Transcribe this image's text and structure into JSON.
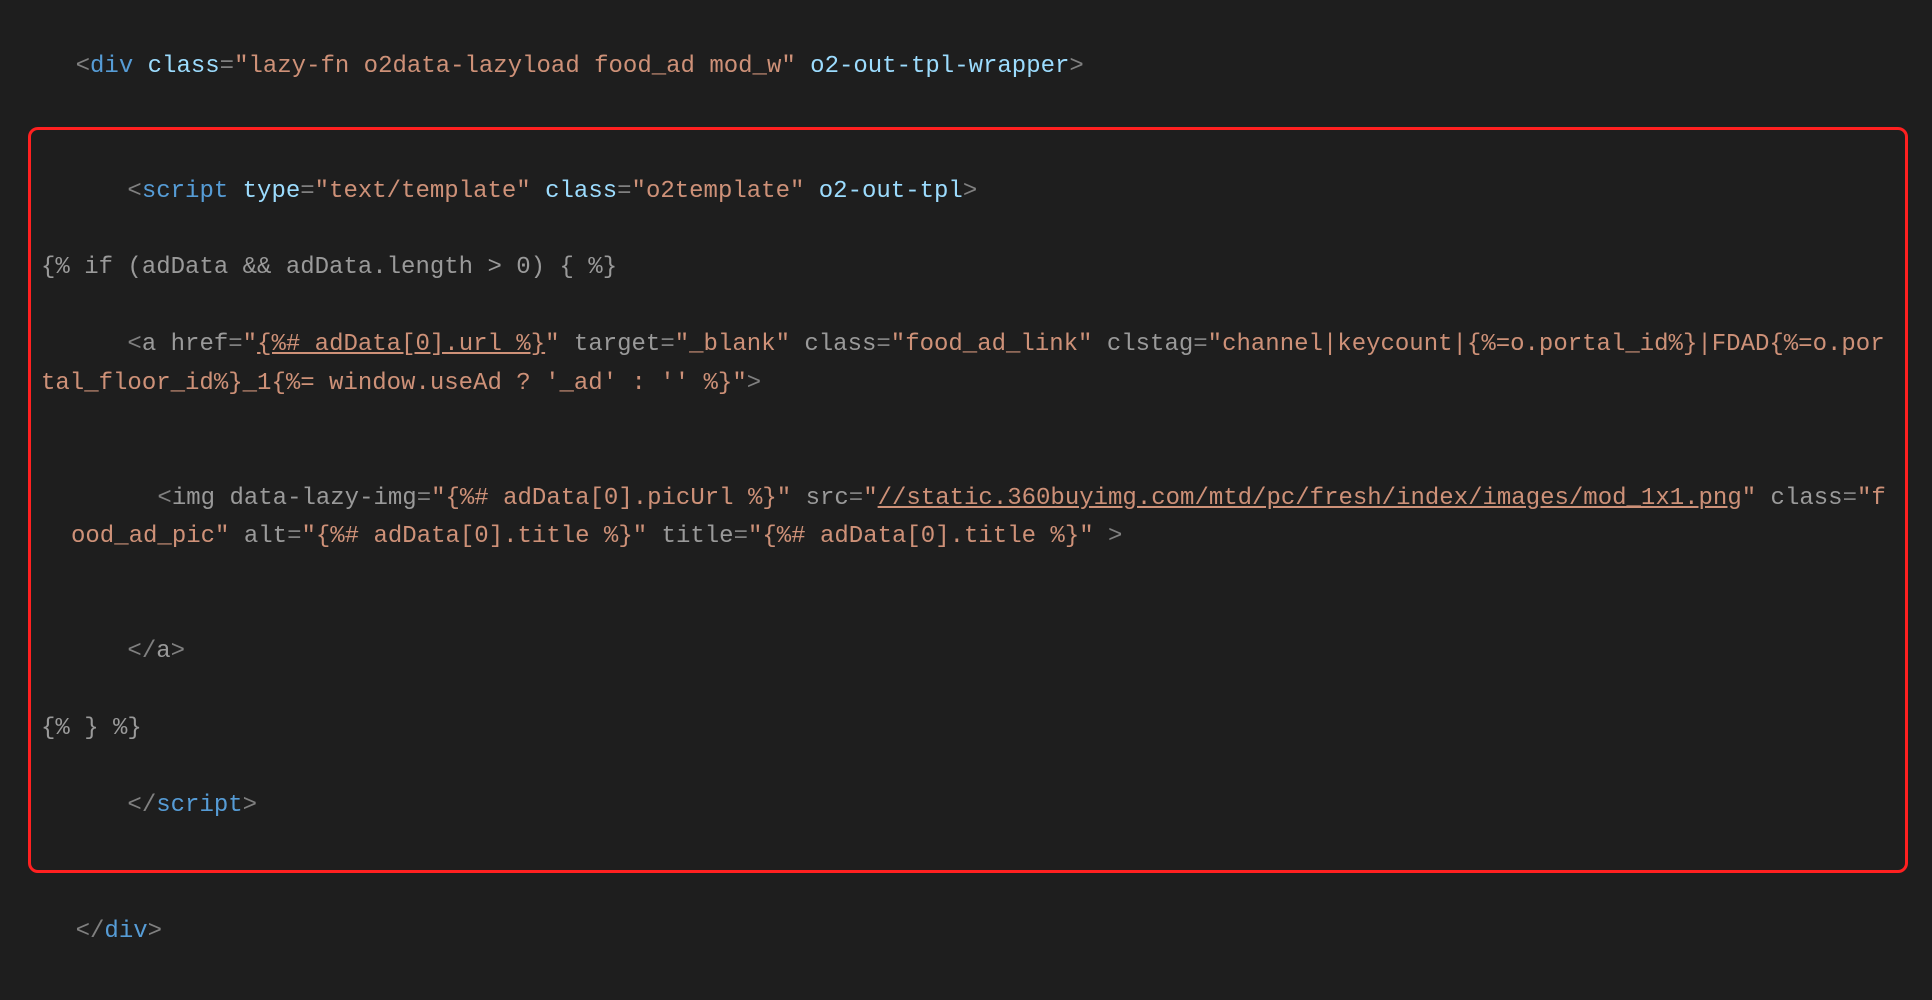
{
  "code": {
    "l1": {
      "open": "<",
      "tag": "div",
      "sp1": " ",
      "attr_class": "class",
      "eq": "=",
      "val_class": "\"lazy-fn o2data-lazyload food_ad mod_w\"",
      "sp2": " ",
      "o2attr": "o2-out-tpl-wrapper",
      "close": ">"
    },
    "l2": {
      "open": "<",
      "tag": "script",
      "sp1": " ",
      "attr_type": "type",
      "eq1": "=",
      "val_type": "\"text/template\"",
      "sp2": " ",
      "attr_class": "class",
      "eq2": "=",
      "val_class": "\"o2template\"",
      "sp3": " ",
      "o2attr": "o2-out-tpl",
      "close": ">"
    },
    "l3": {
      "text": "{% if (adData && adData.length > 0) { %}"
    },
    "l4": {
      "open": "<",
      "tag": "a",
      "sp1": " ",
      "attr_href": "href",
      "eq1": "=",
      "q1": "\"",
      "href_val": "{%# adData[0].url %}",
      "q2": "\"",
      "sp2": " ",
      "attr_target": "target",
      "eq2": "=",
      "val_target": "\"_blank\"",
      "sp3": " ",
      "attr_class": "class",
      "eq3": "=",
      "val_class": "\"food_ad_link\"",
      "sp4": " ",
      "attr_clstag": "clstag",
      "eq4": "=",
      "q3": "\"",
      "clstag_a": "channel|keycount|",
      "clstag_b": "{%=o.portal_id%}|FDAD{%=o.portal_floor_id%}_1{%= window.useAd ? '_ad' : '' %}",
      "q4": "\"",
      "close": ">"
    },
    "l5": {
      "open": "<",
      "tag": "img",
      "sp1": " ",
      "attr_lazy": "data-lazy-img",
      "eq1": "=",
      "val_lazy": "\"{%# adData[0].picUrl %}\"",
      "sp2": " ",
      "attr_src": "src",
      "eq2": "=",
      "q1": "\"",
      "src_val": "//static.360buyimg.com/mtd/pc/fresh/index/images/mod_1x1.png",
      "q2": "\"",
      "sp3": " ",
      "attr_class": "class",
      "eq3": "=",
      "val_class": "\"food_ad_pic\"",
      "sp4": " ",
      "attr_alt": "alt",
      "eq4": "=",
      "q3": "\"",
      "alt_a": "{%# ",
      "alt_b": "adData[0].title %}",
      "q4": "\"",
      "sp5": " ",
      "attr_title": "title",
      "eq5": "=",
      "val_title": "\"{%# adData[0].title %}\"",
      "sp6": " ",
      "close": ">"
    },
    "l6": {
      "open": "</",
      "tag": "a",
      "close": ">"
    },
    "l7": {
      "text": "{% } %}"
    },
    "l8": {
      "open": "</",
      "tag": "script",
      "close": ">"
    },
    "l9": {
      "open": "</",
      "tag": "div",
      "close": ">"
    }
  }
}
